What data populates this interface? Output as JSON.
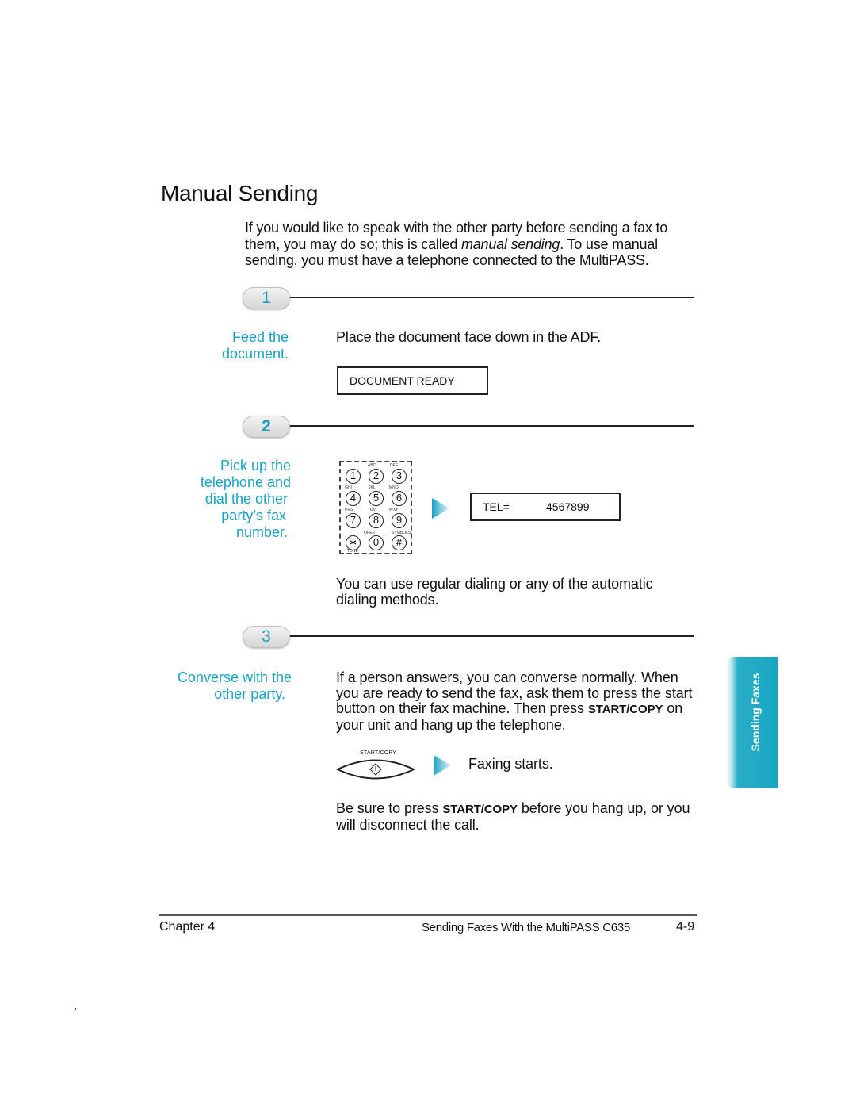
{
  "page": {
    "title": "Manual Sending",
    "intro": {
      "line1": "If you would like to speak with the other party before sending a fax to",
      "line2_pre": "them, you may do so; this is called ",
      "line2_em": "manual sending",
      "line2_post": ". To use manual",
      "line3": "sending, you must have a telephone connected to the MultiPASS."
    }
  },
  "steps": [
    {
      "number": "1",
      "label_lines": [
        "Feed the",
        "document."
      ],
      "instruction": "Place the document face down in the ADF.",
      "lcd": "DOCUMENT READY"
    },
    {
      "number": "2",
      "label_lines": [
        "Pick up the",
        "telephone and",
        "dial the other",
        "party’s fax",
        "number."
      ],
      "keypad": {
        "keys": [
          "1",
          "2",
          "3",
          "4",
          "5",
          "6",
          "7",
          "8",
          "9",
          "∗",
          "0",
          "#"
        ],
        "sublabels": [
          "ABC",
          "DEF",
          "GHI",
          "JKL",
          "MNO",
          "PRS",
          "TUV",
          "WXY",
          "OPER",
          "SYMBOLS",
          "TONE"
        ]
      },
      "lcd_label": "TEL=",
      "lcd_value": "4567899",
      "note_line1": "You can use regular dialing or any of the automatic",
      "note_line2": "dialing methods."
    },
    {
      "number": "3",
      "label_lines": [
        "Converse with the",
        "other party."
      ],
      "para": {
        "line1": "If a person answers, you can converse normally. When",
        "line2": "you are ready to send the fax, ask them to press the start",
        "line3_pre": "button on their fax machine. Then press ",
        "line3_kw": "START/COPY",
        "line3_post": " on",
        "line4": "your unit and hang up the telephone."
      },
      "button_label": "START/COPY",
      "result": "Faxing starts.",
      "warning": {
        "pre": "Be sure to press ",
        "kw": "START/COPY",
        "post": " before you hang up, or you",
        "line2": "will disconnect the call."
      }
    }
  ],
  "side_tab": {
    "label": "Sending Faxes",
    "color": "#16a6c2"
  },
  "footer": {
    "chapter": "Chapter 4",
    "section": "Sending Faxes With the MultiPASS C635",
    "page": "4-9"
  },
  "colors": {
    "accent": "#1aa3c4",
    "text": "#111111"
  }
}
